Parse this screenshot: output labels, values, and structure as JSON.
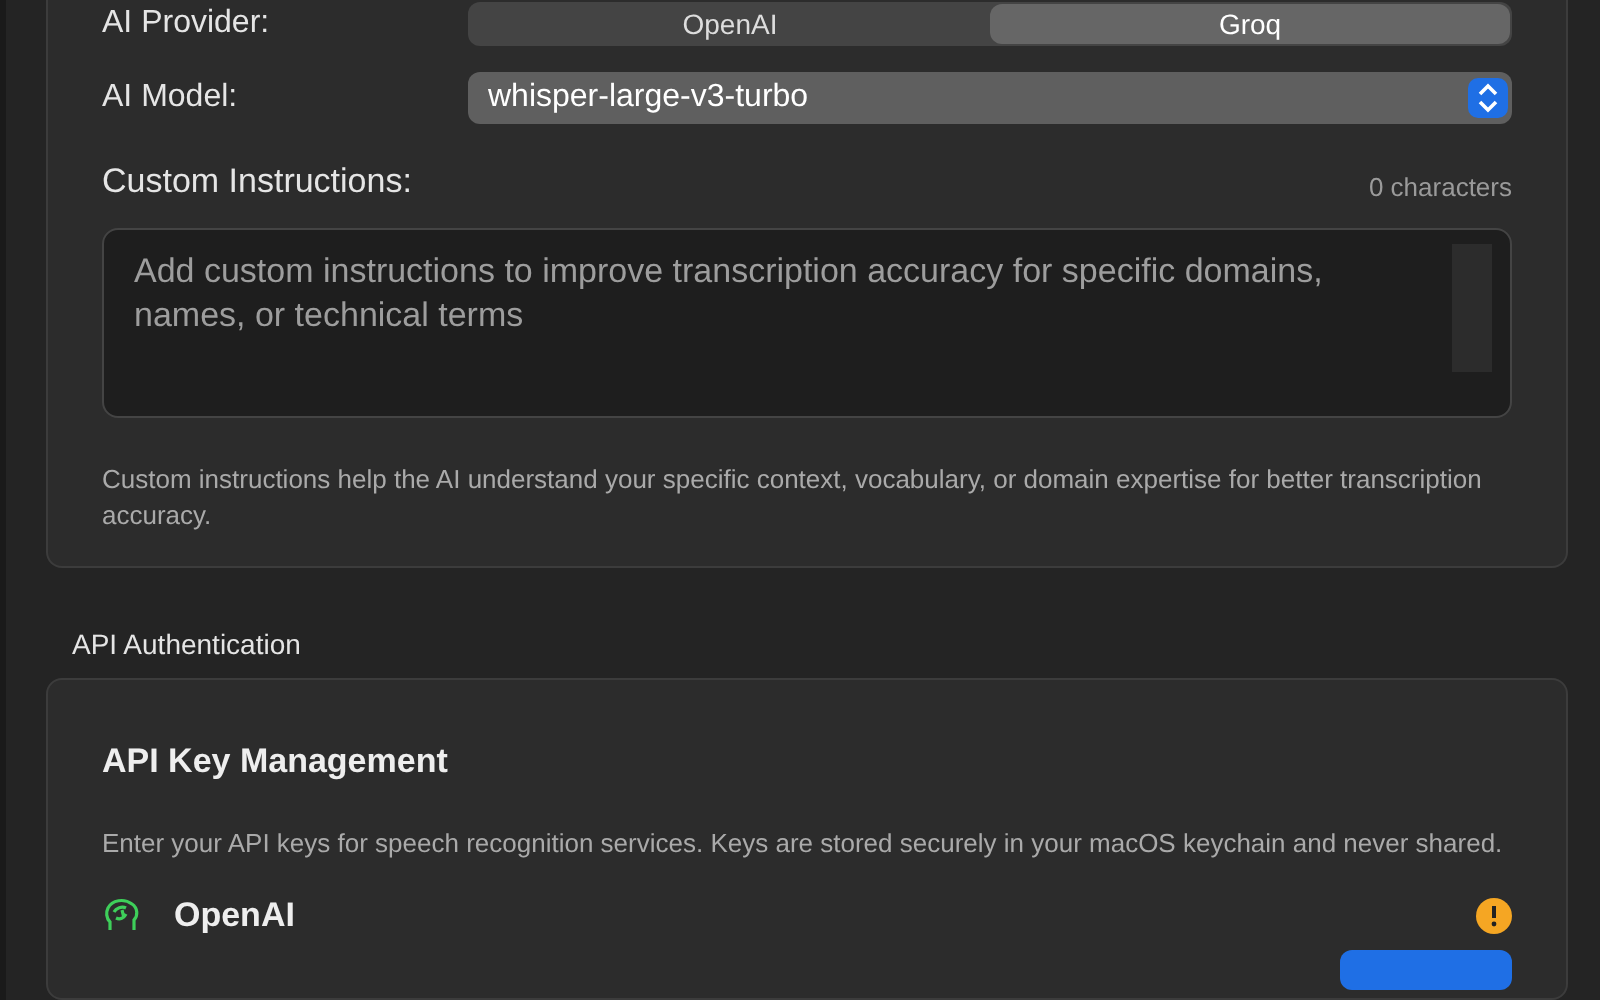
{
  "transcription_card": {
    "provider": {
      "label": "AI Provider:",
      "options": [
        {
          "label": "OpenAI",
          "selected": false
        },
        {
          "label": "Groq",
          "selected": true
        }
      ]
    },
    "model": {
      "label": "AI Model:",
      "value": "whisper-large-v3-turbo"
    },
    "instructions": {
      "label": "Custom Instructions:",
      "count": "0 characters",
      "placeholder": "Add custom instructions to improve transcription accuracy for specific domains, names, or technical terms",
      "help": "Custom instructions help the AI understand your specific context, vocabulary, or domain expertise for better transcription accuracy."
    }
  },
  "auth_section": {
    "title": "API Authentication",
    "heading": "API Key Management",
    "description": "Enter your API keys for speech recognition services. Keys are stored securely in your macOS keychain and never shared.",
    "providers": [
      {
        "name": "OpenAI",
        "warning": true
      }
    ]
  }
}
